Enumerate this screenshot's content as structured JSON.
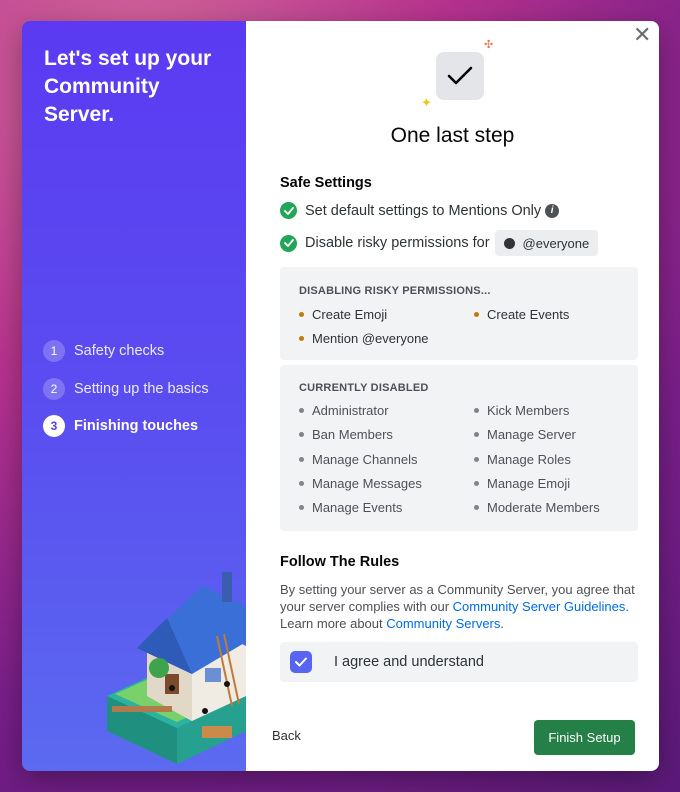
{
  "sidebar": {
    "title": "Let's set up your Community Server.",
    "steps": [
      {
        "number": "1",
        "label": "Safety checks"
      },
      {
        "number": "2",
        "label": "Setting up the basics"
      },
      {
        "number": "3",
        "label": "Finishing touches"
      }
    ]
  },
  "main": {
    "heading": "One last step",
    "safe_settings": {
      "title": "Safe Settings",
      "item1": "Set default settings to Mentions Only",
      "item2": "Disable risky permissions for",
      "role": "@everyone"
    },
    "disabling": {
      "title": "DISABLING RISKY PERMISSIONS...",
      "items": [
        "Create Emoji",
        "Create Events",
        "Mention @everyone"
      ]
    },
    "currently_disabled": {
      "title": "CURRENTLY DISABLED",
      "items": [
        "Administrator",
        "Kick Members",
        "Ban Members",
        "Manage Server",
        "Manage Channels",
        "Manage Roles",
        "Manage Messages",
        "Manage Emoji",
        "Manage Events",
        "Moderate Members"
      ]
    },
    "rules": {
      "title": "Follow The Rules",
      "text1": "By setting your server as a Community Server, you agree that your server complies with our ",
      "link1": "Community Server Guidelines",
      "text2": ". Learn more about ",
      "link2": "Community Servers",
      "text3": "."
    },
    "agree_label": "I agree and understand",
    "agree_checked": true
  },
  "footer": {
    "back_label": "Back",
    "finish_label": "Finish Setup"
  },
  "colors": {
    "accent": "#5865f2",
    "success": "#23a55a",
    "finish_button": "#248046",
    "warning_dot": "#c27c0e",
    "link": "#006ce7"
  }
}
